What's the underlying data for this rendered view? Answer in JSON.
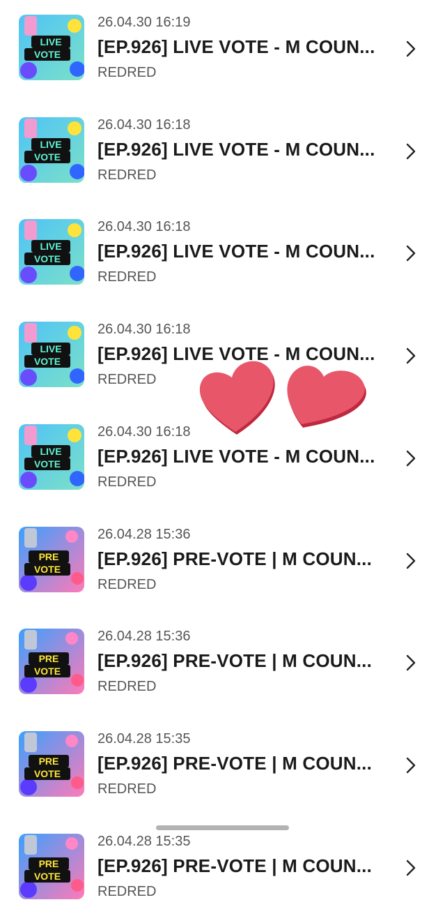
{
  "items": [
    {
      "date": "26.04.30 16:19",
      "title": "[EP.926] LIVE VOTE - M COUN...",
      "artist": "REDRED",
      "badge_top": "LIVE",
      "badge_bottom": "VOTE",
      "kind": "live"
    },
    {
      "date": "26.04.30 16:18",
      "title": "[EP.926] LIVE VOTE - M COUN...",
      "artist": "REDRED",
      "badge_top": "LIVE",
      "badge_bottom": "VOTE",
      "kind": "live"
    },
    {
      "date": "26.04.30 16:18",
      "title": "[EP.926] LIVE VOTE - M COUN...",
      "artist": "REDRED",
      "badge_top": "LIVE",
      "badge_bottom": "VOTE",
      "kind": "live"
    },
    {
      "date": "26.04.30 16:18",
      "title": "[EP.926] LIVE VOTE - M COUN...",
      "artist": "REDRED",
      "badge_top": "LIVE",
      "badge_bottom": "VOTE",
      "kind": "live"
    },
    {
      "date": "26.04.30 16:18",
      "title": "[EP.926] LIVE VOTE - M COUN...",
      "artist": "REDRED",
      "badge_top": "LIVE",
      "badge_bottom": "VOTE",
      "kind": "live"
    },
    {
      "date": "26.04.28 15:36",
      "title": "[EP.926] PRE-VOTE | M COUN...",
      "artist": "REDRED",
      "badge_top": "PRE",
      "badge_bottom": "VOTE",
      "kind": "pre"
    },
    {
      "date": "26.04.28 15:36",
      "title": "[EP.926] PRE-VOTE | M COUN...",
      "artist": "REDRED",
      "badge_top": "PRE",
      "badge_bottom": "VOTE",
      "kind": "pre"
    },
    {
      "date": "26.04.28 15:35",
      "title": "[EP.926] PRE-VOTE | M COUN...",
      "artist": "REDRED",
      "badge_top": "PRE",
      "badge_bottom": "VOTE",
      "kind": "pre"
    },
    {
      "date": "26.04.28 15:35",
      "title": "[EP.926] PRE-VOTE | M COUN...",
      "artist": "REDRED",
      "badge_top": "PRE",
      "badge_bottom": "VOTE",
      "kind": "pre"
    }
  ],
  "icons": {
    "chevron": "chevron-right-icon",
    "overlay": "heart-sticker-icon"
  },
  "colors": {
    "live_bg_top": "#4fc3f7",
    "live_bg_bottom": "#7be0c8",
    "pre_bg_top": "#3aa0ff",
    "pre_bg_bottom": "#ff7ab8",
    "badge_black": "#111111",
    "live_badge_text": "#5ff5d6",
    "pre_badge_text": "#ffe83a",
    "heart": "#e8566a",
    "heart_shadow": "#c0283f"
  }
}
